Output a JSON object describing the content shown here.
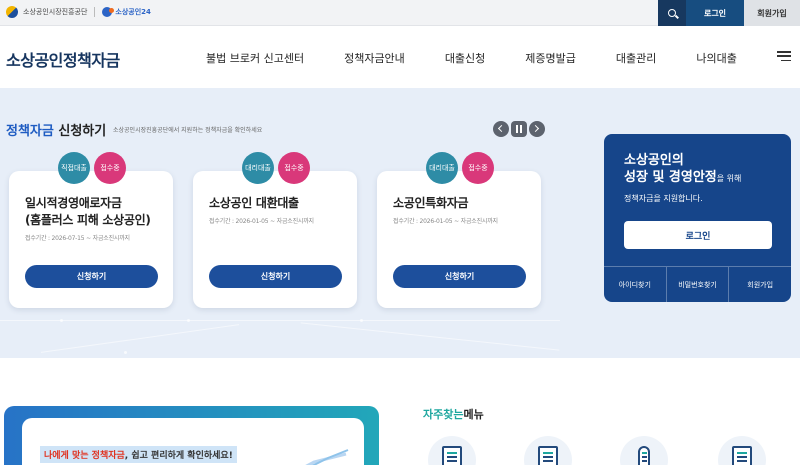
{
  "topbar": {
    "org_name": "소상공인시장진흥공단",
    "org2_name": "소상공인24",
    "login_label": "로그인",
    "join_label": "회원가입"
  },
  "header": {
    "logo": "소상공인정책자금",
    "nav": [
      "불법 브로커 신고센터",
      "정책자금안내",
      "대출신청",
      "제증명발급",
      "대출관리",
      "나의대출"
    ]
  },
  "hero": {
    "title_highlight": "정책자금",
    "title_rest": " 신청하기",
    "subtitle": "소상공인시장진흥공단에서 지원하는 정책자금을 확인하세요",
    "cards": [
      {
        "type": "직접대출",
        "status": "접수중",
        "title_line1": "일시적경영애로자금",
        "title_line2": "(홈플러스 피해 소상공인)",
        "period": "접수기간 : 2026-07-15 ~ 자금소진시까지",
        "button": "신청하기"
      },
      {
        "type": "대리대출",
        "status": "접수중",
        "title_line1": "소상공인 대환대출",
        "title_line2": "",
        "period": "접수기간 : 2026-01-05 ~ 자금소진시까지",
        "button": "신청하기"
      },
      {
        "type": "대리대출",
        "status": "접수중",
        "title_line1": "소공인특화자금",
        "title_line2": "",
        "period": "접수기간 : 2026-01-05 ~ 자금소진시까지",
        "button": "신청하기"
      }
    ]
  },
  "login_panel": {
    "line1": "소상공인의",
    "line2": "성장 및 경영안정",
    "line2_suffix": "을 위해",
    "line3": "정책자금을 지원합니다.",
    "login_button": "로그인",
    "links": [
      "아이디찾기",
      "비밀번호찾기",
      "회원가입"
    ]
  },
  "promo": {
    "text_red": "나에게 맞는 정책자금",
    "text_rest": ", 쉽고 편리하게 확인하세요!"
  },
  "frequent": {
    "title_teal": "자주찾는",
    "title_rest": "메뉴"
  }
}
